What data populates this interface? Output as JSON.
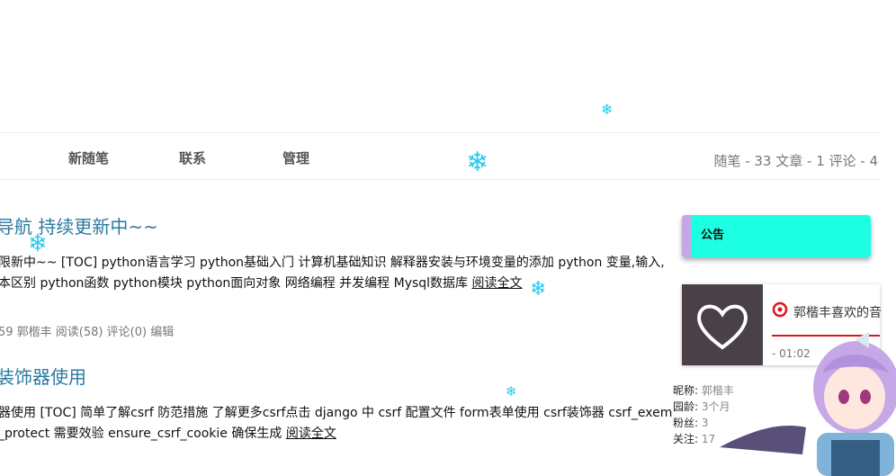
{
  "nav": {
    "items": [
      "新随笔",
      "联系",
      "管理"
    ],
    "stats": "随笔 - 33  文章 - 1  评论 - 4"
  },
  "posts": [
    {
      "title": "导航 持续更新中~~",
      "summary_line1": "限新中~~ [TOC] python语言学习 python基础入门 计算机基础知识 解释器安装与环境变量的添加 python 变量,输入,",
      "summary_line2": "本区别 python函数 python模块 python面向对象 网络编程 并发编程 Mysql数据库",
      "read_more": "阅读全文",
      "meta": "59 郭楷丰 阅读(58) 评论(0)",
      "edit": "编辑"
    },
    {
      "title": "装饰器使用",
      "summary_line1": "器使用 [TOC] 简单了解csrf 防范措施 了解更多csrf点击 django 中 csrf 配置文件 form表单使用 csrf装饰器 csrf_exem",
      "summary_line2": "_protect 需要效验 ensure_csrf_cookie 确保生成",
      "read_more": "阅读全文"
    }
  ],
  "sidebar": {
    "notice_title": "公告",
    "player": {
      "title": "郭楷丰喜欢的音",
      "time": "- 01:02"
    },
    "profile": [
      {
        "label": "昵称:",
        "value": "郭楷丰"
      },
      {
        "label": "园龄:",
        "value": "3个月"
      },
      {
        "label": "粉丝:",
        "value": "3"
      },
      {
        "label": "关注:",
        "value": "17"
      }
    ]
  },
  "colors": {
    "notice_bg": "#1dffe2",
    "notice_stripe": "#c7a6e8",
    "link": "#2a7aa0",
    "accent_red": "#e0121b",
    "snowflake": "#25c9ee"
  },
  "icons": [
    "snowflake-icon",
    "netease-music-icon",
    "heart-icon"
  ]
}
